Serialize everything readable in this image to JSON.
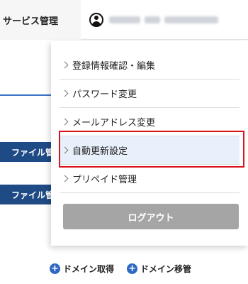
{
  "header": {
    "service_link": "サービス管理",
    "account_icon": "user-circle-icon",
    "account_blurred": true
  },
  "page": {
    "file_buttons": [
      "ファイル管",
      "ファイル管"
    ],
    "domain_links": [
      {
        "label": "ドメイン取得",
        "icon": "plus-circle-icon"
      },
      {
        "label": "ドメイン移管",
        "icon": "plus-circle-icon"
      }
    ]
  },
  "dropdown": {
    "items": [
      {
        "label": "登録情報確認・編集"
      },
      {
        "label": "パスワード変更"
      },
      {
        "label": "メールアドレス変更"
      },
      {
        "label": "自動更新設定",
        "highlighted": true
      },
      {
        "label": "プリペイド管理"
      }
    ],
    "logout_label": "ログアウト"
  },
  "colors": {
    "highlight_border": "#d9131a",
    "highlight_bg": "#e8f0fb",
    "primary_button": "#1e4a86",
    "link_icon": "#2d68c4",
    "logout_button": "#a5a5a5"
  }
}
